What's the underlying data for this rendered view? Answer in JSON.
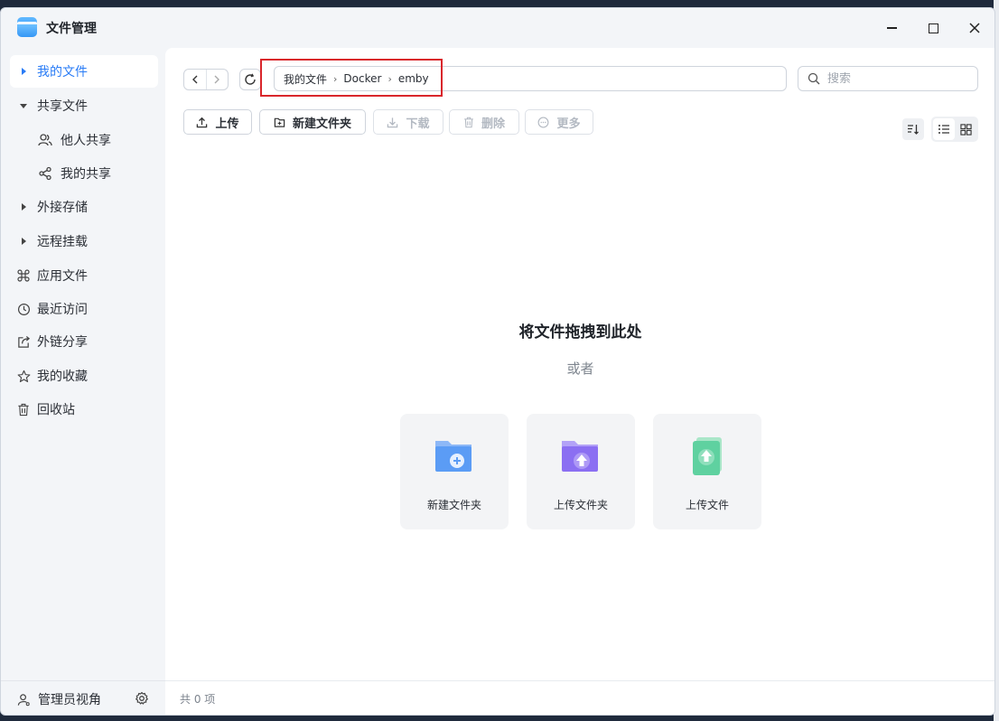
{
  "window": {
    "title": "文件管理"
  },
  "sidebar": {
    "items": [
      {
        "label": "我的文件",
        "active": true
      },
      {
        "label": "共享文件"
      },
      {
        "label": "他人共享"
      },
      {
        "label": "我的共享"
      },
      {
        "label": "外接存储"
      },
      {
        "label": "远程挂载"
      },
      {
        "label": "应用文件"
      },
      {
        "label": "最近访问"
      },
      {
        "label": "外链分享"
      },
      {
        "label": "我的收藏"
      },
      {
        "label": "回收站"
      }
    ],
    "footer": {
      "admin_label": "管理员视角"
    }
  },
  "path": {
    "crumbs": [
      "我的文件",
      "Docker",
      "emby"
    ]
  },
  "search": {
    "placeholder": "搜索"
  },
  "toolbar": {
    "upload_label": "上传",
    "new_folder_label": "新建文件夹",
    "download_label": "下载",
    "delete_label": "删除",
    "more_label": "更多"
  },
  "drop_zone": {
    "title": "将文件拖拽到此处",
    "or_text": "或者",
    "cards": [
      {
        "label": "新建文件夹",
        "color": "#5b9cf5"
      },
      {
        "label": "上传文件夹",
        "color": "#8b6ff2"
      },
      {
        "label": "上传文件",
        "color": "#5fd1a0"
      }
    ]
  },
  "status": {
    "count_text": "共 0 项"
  },
  "colors": {
    "accent": "#2a7cf6",
    "highlight_box": "#d9262b"
  }
}
